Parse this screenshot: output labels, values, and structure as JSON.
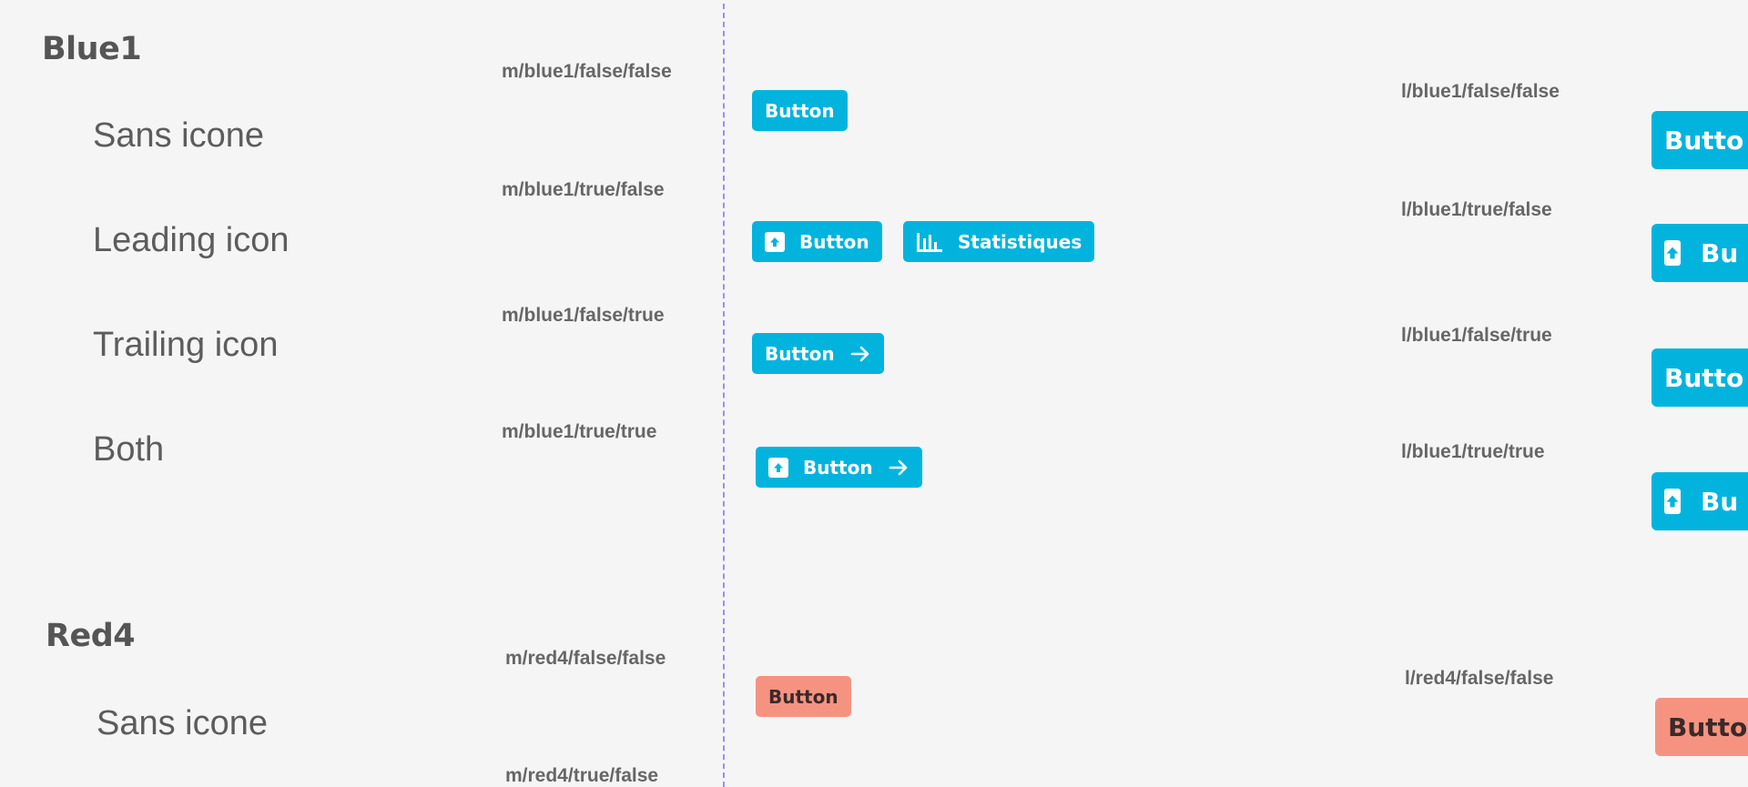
{
  "sections": {
    "blue1": {
      "title": "Blue1",
      "rows": [
        "Sans icone",
        "Leading icon",
        "Trailing icon",
        "Both"
      ],
      "m_variants": [
        "m/blue1/false/false",
        "m/blue1/true/false",
        "m/blue1/false/true",
        "m/blue1/true/true"
      ],
      "l_variants": [
        "l/blue1/false/false",
        "l/blue1/true/false",
        "l/blue1/false/true",
        "l/blue1/true/true"
      ]
    },
    "red4": {
      "title": "Red4",
      "rows": [
        "Sans icone"
      ],
      "m_variants": [
        "m/red4/false/false",
        "m/red4/true/false"
      ],
      "l_variants": [
        "l/red4/false/false"
      ]
    }
  },
  "buttons": {
    "label": "Button",
    "stats_label": "Statistiques",
    "large_visible_labels": [
      "Butto",
      "Bu",
      "Butto",
      "Bu",
      "Butto"
    ]
  },
  "colors": {
    "blue1": "#02b4dd",
    "red4": "#f69380",
    "divider": "#9a8ff0"
  },
  "icons": {
    "leading": "upload-box-icon",
    "trailing": "arrow-right-icon",
    "stats": "bar-chart-icon"
  }
}
